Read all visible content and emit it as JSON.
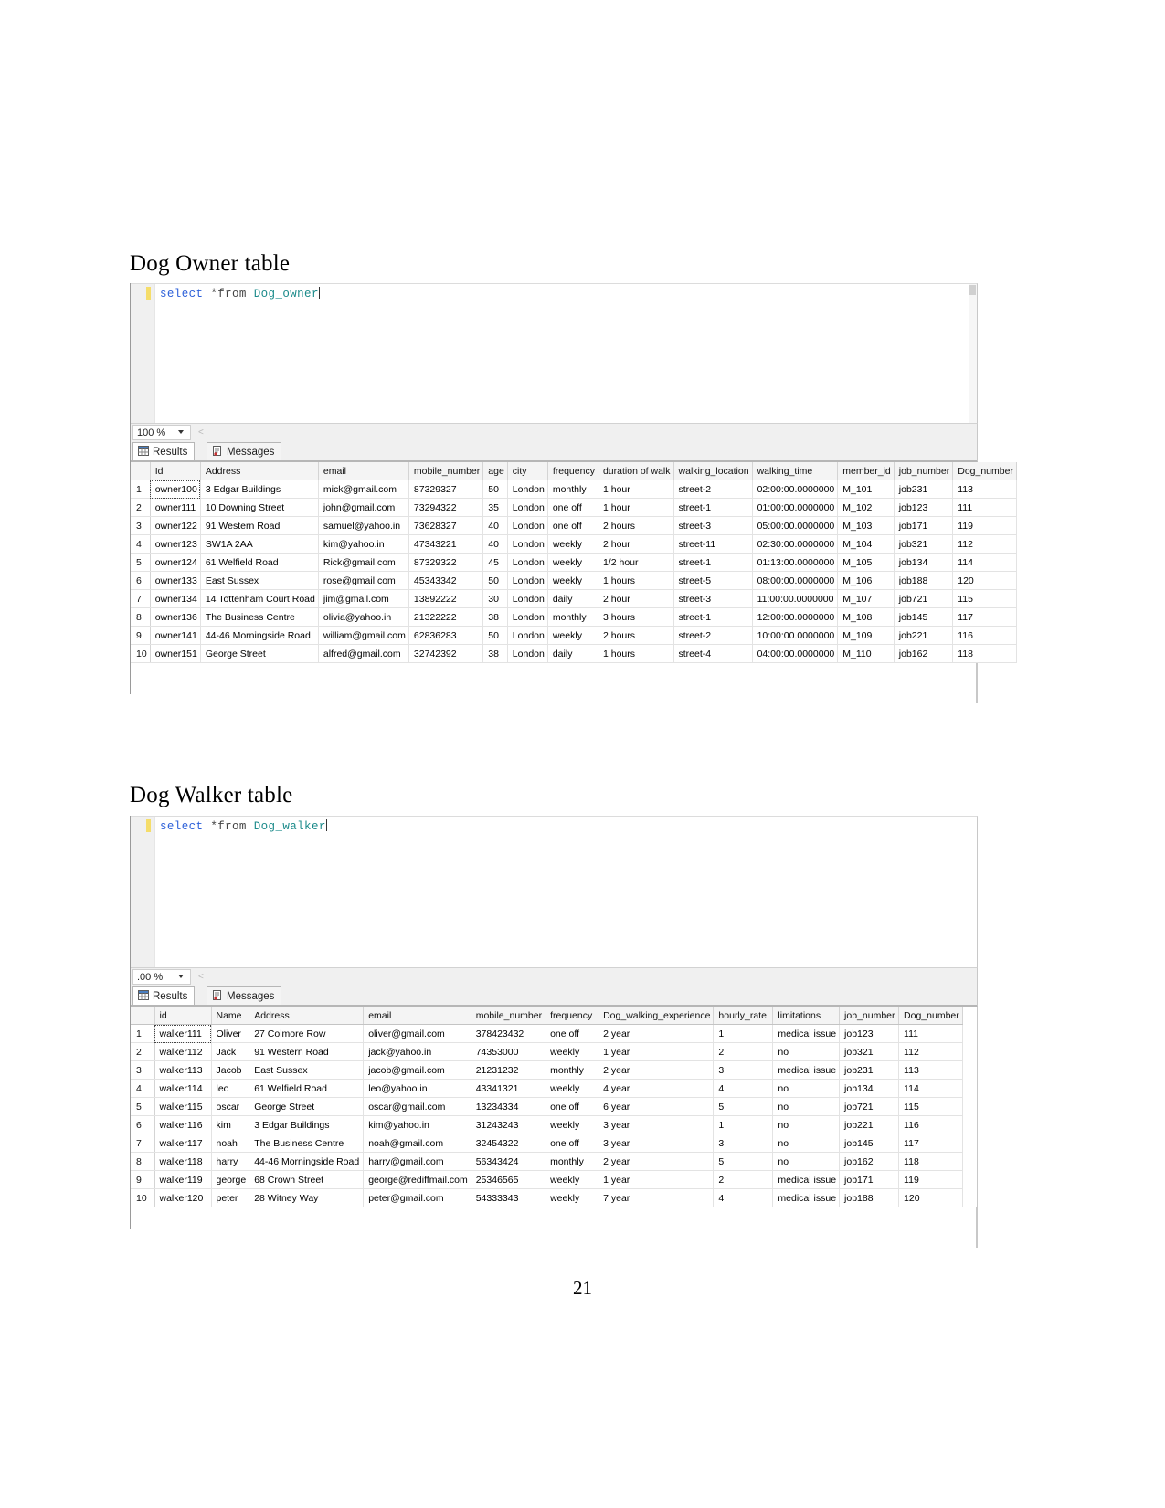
{
  "document": {
    "heading_owner": "Dog Owner table",
    "heading_walker": "Dog Walker table",
    "page_number": "21"
  },
  "owner_panel": {
    "query": {
      "keyword": "select",
      "star_from": "*from",
      "table": "Dog_owner"
    },
    "zoom": {
      "value": "100 %",
      "dropdown_icon": "chevron-down-icon",
      "split_glyph": "<"
    },
    "tabs": [
      {
        "label": "Results",
        "icon": "grid-icon",
        "active": true
      },
      {
        "label": "Messages",
        "icon": "message-icon",
        "active": false
      }
    ],
    "grid": {
      "columns": [
        "Id",
        "Address",
        "email",
        "mobile_number",
        "age",
        "city",
        "frequency",
        "duration of walk",
        "walking_location",
        "walking_time",
        "member_id",
        "job_number",
        "Dog_number"
      ],
      "rows": [
        [
          "1",
          "owner100",
          "3 Edgar Buildings",
          "mick@gmail.com",
          "87329327",
          "50",
          "London",
          "monthly",
          "1 hour",
          "street-2",
          "02:00:00.0000000",
          "M_101",
          "job231",
          "113"
        ],
        [
          "2",
          "owner111",
          "10 Downing Street",
          "john@gmail.com",
          "73294322",
          "35",
          "London",
          "one off",
          "1 hour",
          "street-1",
          "01:00:00.0000000",
          "M_102",
          "job123",
          "111"
        ],
        [
          "3",
          "owner122",
          "91 Western Road",
          "samuel@yahoo.in",
          "73628327",
          "40",
          "London",
          "one off",
          "2 hours",
          "street-3",
          "05:00:00.0000000",
          "M_103",
          "job171",
          "119"
        ],
        [
          "4",
          "owner123",
          "SW1A 2AA",
          "kim@yahoo.in",
          "47343221",
          "40",
          "London",
          "weekly",
          "2 hour",
          "street-11",
          "02:30:00.0000000",
          "M_104",
          "job321",
          "112"
        ],
        [
          "5",
          "owner124",
          "61 Welfield Road",
          "Rick@gmail.com",
          "87329322",
          "45",
          "London",
          "weekly",
          "1/2 hour",
          "street-1",
          "01:13:00.0000000",
          "M_105",
          "job134",
          "114"
        ],
        [
          "6",
          "owner133",
          "East Sussex",
          "rose@gmail.com",
          "45343342",
          "50",
          "London",
          "weekly",
          "1 hours",
          "street-5",
          "08:00:00.0000000",
          "M_106",
          "job188",
          "120"
        ],
        [
          "7",
          "owner134",
          "14 Tottenham Court Road",
          "jim@gmail.com",
          "13892222",
          "30",
          "London",
          "daily",
          "2 hour",
          "street-3",
          "11:00:00.0000000",
          "M_107",
          "job721",
          "115"
        ],
        [
          "8",
          "owner136",
          "The Business Centre",
          "olivia@yahoo.in",
          "21322222",
          "38",
          "London",
          "monthly",
          "3 hours",
          "street-1",
          "12:00:00.0000000",
          "M_108",
          "job145",
          "117"
        ],
        [
          "9",
          "owner141",
          "44-46 Morningside Road",
          "william@gmail.com",
          "62836283",
          "50",
          "London",
          "weekly",
          "2 hours",
          "street-2",
          "10:00:00.0000000",
          "M_109",
          "job221",
          "116"
        ],
        [
          "10",
          "owner151",
          "George Street",
          "alfred@gmail.com",
          "32742392",
          "38",
          "London",
          "daily",
          "1 hours",
          "street-4",
          "04:00:00.0000000",
          "M_110",
          "job162",
          "118"
        ]
      ]
    }
  },
  "walker_panel": {
    "query": {
      "keyword": "select",
      "star_from": "*from",
      "table": "Dog_walker"
    },
    "zoom": {
      "value": ".00 %",
      "dropdown_icon": "chevron-down-icon",
      "split_glyph": "<"
    },
    "tabs": [
      {
        "label": "Results",
        "icon": "grid-icon",
        "active": true
      },
      {
        "label": "Messages",
        "icon": "message-icon",
        "active": false
      }
    ],
    "grid": {
      "columns": [
        "id",
        "Name",
        "Address",
        "email",
        "mobile_number",
        "frequency",
        "Dog_walking_experience",
        "hourly_rate",
        "limitations",
        "job_number",
        "Dog_number"
      ],
      "rows": [
        [
          "1",
          "walker111",
          "Oliver",
          "27 Colmore Row",
          "oliver@gmail.com",
          "378423432",
          "one off",
          "2 year",
          "1",
          "medical issue",
          "job123",
          "111"
        ],
        [
          "2",
          "walker112",
          "Jack",
          "91 Western Road",
          "jack@yahoo.in",
          "74353000",
          "weekly",
          "1 year",
          "2",
          "no",
          "job321",
          "112"
        ],
        [
          "3",
          "walker113",
          "Jacob",
          "East Sussex",
          "jacob@gmail.com",
          "21231232",
          "monthly",
          "2 year",
          "3",
          "medical issue",
          "job231",
          "113"
        ],
        [
          "4",
          "walker114",
          "leo",
          "61 Welfield Road",
          "leo@yahoo.in",
          "43341321",
          "weekly",
          "4 year",
          "4",
          "no",
          "job134",
          "114"
        ],
        [
          "5",
          "walker115",
          "oscar",
          "George Street",
          "oscar@gmail.com",
          "13234334",
          "one off",
          "6 year",
          "5",
          "no",
          "job721",
          "115"
        ],
        [
          "6",
          "walker116",
          "kim",
          "3 Edgar Buildings",
          "kim@yahoo.in",
          "31243243",
          "weekly",
          "3 year",
          "1",
          "no",
          "job221",
          "116"
        ],
        [
          "7",
          "walker117",
          "noah",
          "The Business Centre",
          "noah@gmail.com",
          "32454322",
          "one off",
          "3 year",
          "3",
          "no",
          "job145",
          "117"
        ],
        [
          "8",
          "walker118",
          "harry",
          "44-46 Morningside Road",
          "harry@gmail.com",
          "56343424",
          "monthly",
          "2 year",
          "5",
          "no",
          "job162",
          "118"
        ],
        [
          "9",
          "walker119",
          "george",
          "68 Crown Street",
          "george@rediffmail.com",
          "25346565",
          "weekly",
          "1 year",
          "2",
          "medical issue",
          "job171",
          "119"
        ],
        [
          "10",
          "walker120",
          "peter",
          "28 Witney Way",
          "peter@gmail.com",
          "54333343",
          "weekly",
          "7 year",
          "4",
          "medical issue",
          "job188",
          "120"
        ]
      ]
    }
  }
}
